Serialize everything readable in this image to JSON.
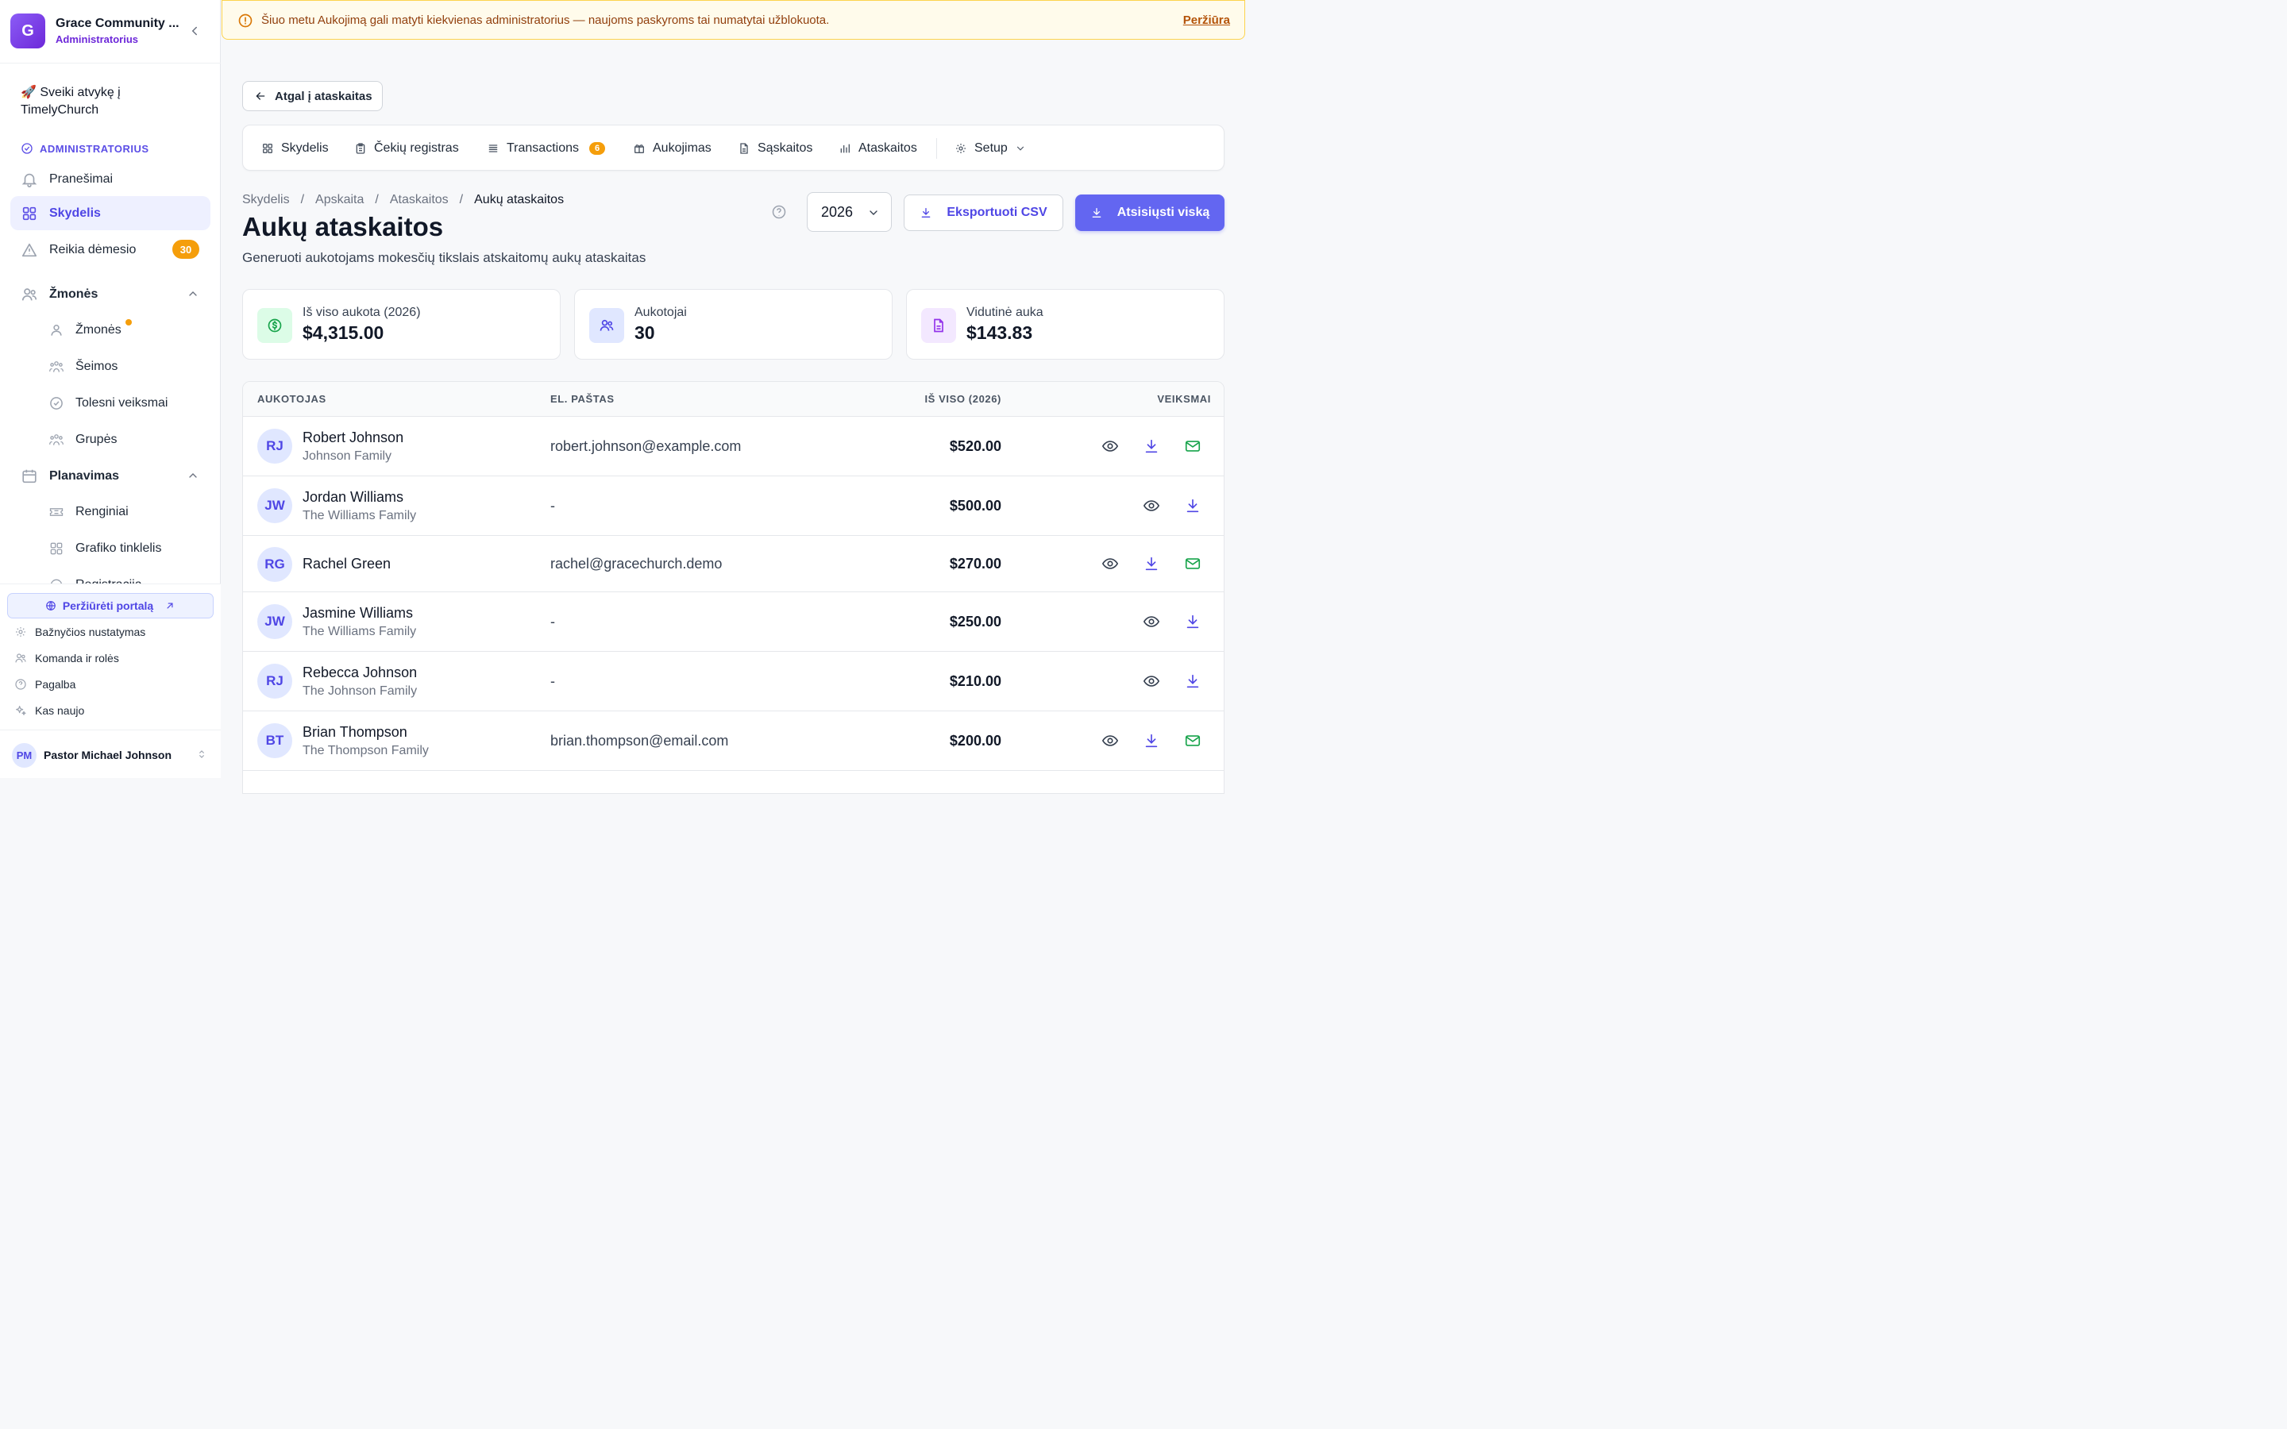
{
  "org": {
    "initial": "G",
    "name": "Grace Community ...",
    "role": "Administratorius"
  },
  "sidebar": {
    "welcome": "🚀 Sveiki atvykę į TimelyChurch",
    "section": "ADMINISTRATORIUS",
    "items": [
      {
        "label": "Pranešimai"
      },
      {
        "label": "Skydelis"
      },
      {
        "label": "Reikia dėmesio",
        "badge": "30"
      }
    ],
    "people_group": "Žmonės",
    "people_items": [
      "Žmonės",
      "Šeimos",
      "Tolesni veiksmai",
      "Grupės"
    ],
    "planning_group": "Planavimas",
    "planning_items": [
      "Renginiai",
      "Grafiko tinklelis",
      "Registracija"
    ],
    "portal": "Peržiūrėti portalą",
    "utils": [
      "Bažnyčios nustatymas",
      "Komanda ir rolės",
      "Pagalba",
      "Kas naujo"
    ],
    "user": {
      "initials": "PM",
      "name": "Pastor Michael Johnson"
    }
  },
  "banner": {
    "text": "Šiuo metu Aukojimą gali matyti kiekvienas administratorius — naujoms paskyroms tai numatytai užblokuota.",
    "link": "Peržiūra"
  },
  "back_label": "Atgal į ataskaitas",
  "tabs": [
    {
      "label": "Skydelis"
    },
    {
      "label": "Čekių registras"
    },
    {
      "label": "Transactions",
      "badge": "6"
    },
    {
      "label": "Aukojimas"
    },
    {
      "label": "Sąskaitos"
    },
    {
      "label": "Ataskaitos"
    },
    {
      "label": "Setup"
    }
  ],
  "breadcrumb": [
    "Skydelis",
    "Apskaita",
    "Ataskaitos",
    "Aukų ataskaitos"
  ],
  "title": "Aukų ataskaitos",
  "subtitle": "Generuoti aukotojams mokesčių tikslais atskaitomų aukų ataskaitas",
  "year": "2026",
  "export_label": "Eksportuoti CSV",
  "download_label": "Atsisiųsti viską",
  "stats": [
    {
      "label": "Iš viso aukota (2026)",
      "value": "$4,315.00",
      "icon": "dollar-icon",
      "color": "#16a34a",
      "bg": "#dcfce7"
    },
    {
      "label": "Aukotojai",
      "value": "30",
      "icon": "users-icon",
      "color": "#4f46e5",
      "bg": "#e0e7ff"
    },
    {
      "label": "Vidutinė auka",
      "value": "$143.83",
      "icon": "document-icon",
      "color": "#9333ea",
      "bg": "#f3e8ff"
    }
  ],
  "table": {
    "headers": {
      "donor": "AUKOTOJAS",
      "email": "EL. PAŠTAS",
      "total": "IŠ VISO (2026)",
      "actions": "VEIKSMAI"
    },
    "rows": [
      {
        "initials": "RJ",
        "name": "Robert Johnson",
        "family": "Johnson Family",
        "email": "robert.johnson@example.com",
        "total": "$520.00",
        "has_email": true
      },
      {
        "initials": "JW",
        "name": "Jordan Williams",
        "family": "The Williams Family",
        "email": "-",
        "total": "$500.00",
        "has_email": false
      },
      {
        "initials": "RG",
        "name": "Rachel Green",
        "family": "",
        "email": "rachel@gracechurch.demo",
        "total": "$270.00",
        "has_email": true
      },
      {
        "initials": "JW",
        "name": "Jasmine Williams",
        "family": "The Williams Family",
        "email": "-",
        "total": "$250.00",
        "has_email": false
      },
      {
        "initials": "RJ",
        "name": "Rebecca Johnson",
        "family": "The Johnson Family",
        "email": "-",
        "total": "$210.00",
        "has_email": false
      },
      {
        "initials": "BT",
        "name": "Brian Thompson",
        "family": "The Thompson Family",
        "email": "brian.thompson@email.com",
        "total": "$200.00",
        "has_email": true
      }
    ]
  }
}
